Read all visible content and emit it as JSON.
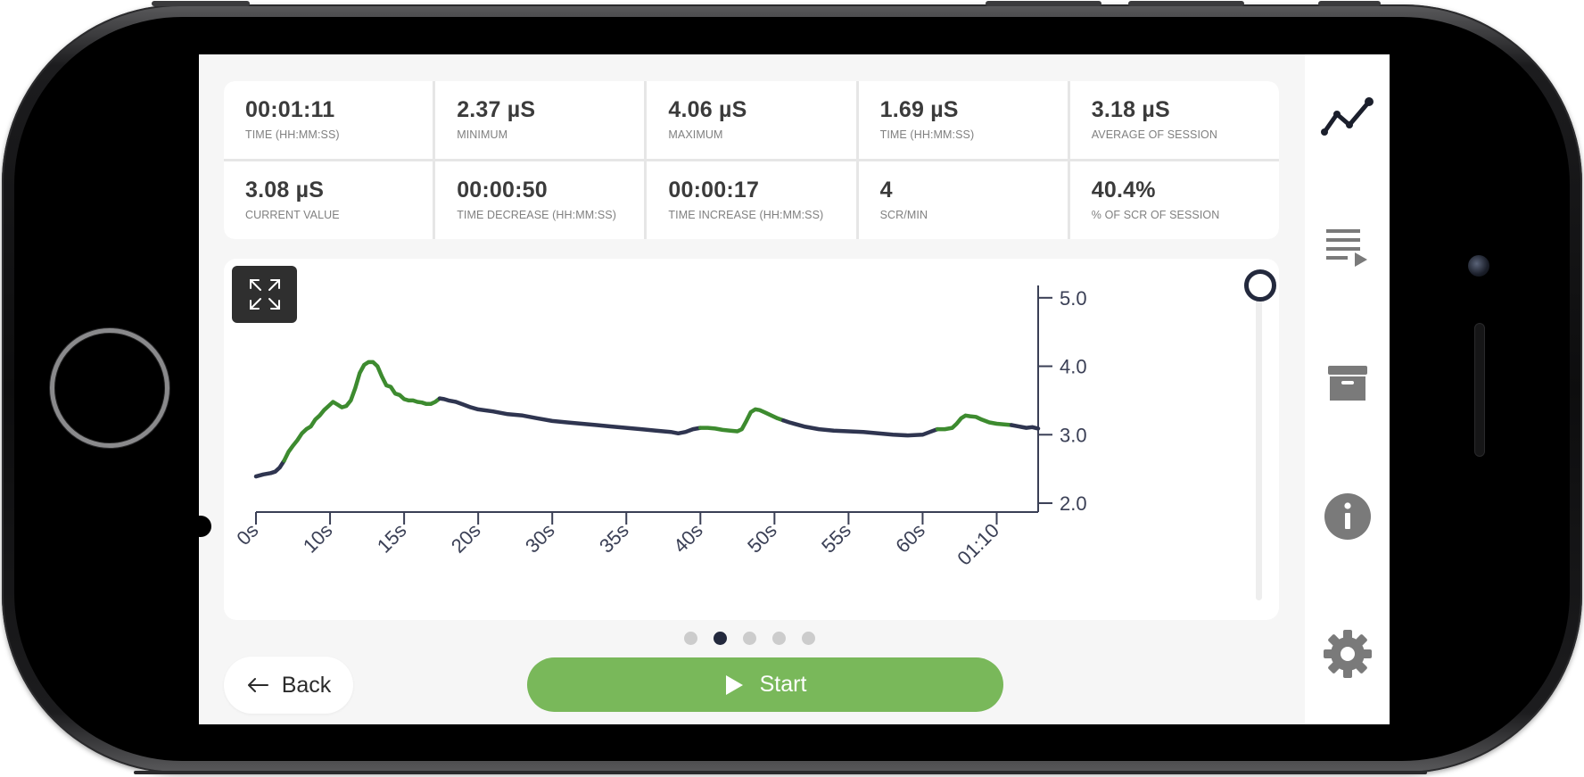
{
  "stats": [
    {
      "value": "00:01:11",
      "label": "TIME (HH:MM:SS)"
    },
    {
      "value": "2.37 µS",
      "label": "MINIMUM"
    },
    {
      "value": "4.06 µS",
      "label": "MAXIMUM"
    },
    {
      "value": "1.69 µS",
      "label": "TIME (HH:MM:SS)"
    },
    {
      "value": "3.18 µS",
      "label": "AVERAGE OF SESSION"
    },
    {
      "value": "3.08 µS",
      "label": "CURRENT VALUE"
    },
    {
      "value": "00:00:50",
      "label": "TIME DECREASE (HH:MM:SS)"
    },
    {
      "value": "00:00:17",
      "label": "TIME INCREASE (HH:MM:SS)"
    },
    {
      "value": "4",
      "label": "SCR/MIN"
    },
    {
      "value": "40.4%",
      "label": "% of SCR OF SESSION"
    }
  ],
  "icons": {
    "expand": "expand-icon",
    "nav": [
      "line-chart-icon",
      "playlist-icon",
      "archive-icon",
      "info-icon",
      "settings-icon"
    ],
    "back": "arrow-left-icon",
    "start": "play-icon"
  },
  "colors": {
    "series_normal": "#2f3550",
    "series_scr": "#3d8b2f",
    "start_button": "#79b85a",
    "slider_thumb": "#23293d"
  },
  "pager": {
    "count": 5,
    "active": 1
  },
  "buttons": {
    "back": "Back",
    "start": "Start"
  },
  "chart_data": {
    "type": "line",
    "xlabel": "",
    "ylabel": "",
    "xticks": [
      0,
      5,
      10,
      15,
      20,
      25,
      30,
      35,
      40,
      45,
      50,
      55,
      60
    ],
    "xtick_labels": [
      "0s",
      "10s",
      "15s",
      "20s",
      "30s",
      "35s",
      "40s",
      "50s",
      "55s",
      "60s",
      "01:10"
    ],
    "xtick_positions": [
      0,
      5,
      10,
      15,
      20,
      25,
      30,
      35,
      40,
      45,
      50
    ],
    "yticks": [
      2.0,
      3.0,
      4.0,
      5.0
    ],
    "ytick_labels": [
      "2.0",
      "3.0",
      "4.0",
      "5.0"
    ],
    "ylim": [
      1.87,
      5.18
    ],
    "xlim": [
      0,
      52.8
    ],
    "y_axis_position": "right",
    "series": [
      {
        "points": [
          [
            0.0,
            2.39
          ],
          [
            0.5,
            2.42
          ],
          [
            1.0,
            2.44
          ],
          [
            1.3,
            2.46
          ],
          [
            1.6,
            2.52
          ],
          [
            1.9,
            2.62
          ],
          [
            2.2,
            2.75
          ],
          [
            2.5,
            2.84
          ],
          [
            2.8,
            2.92
          ],
          [
            3.1,
            3.02
          ],
          [
            3.4,
            3.08
          ],
          [
            3.7,
            3.12
          ],
          [
            4.0,
            3.22
          ],
          [
            4.3,
            3.28
          ],
          [
            4.6,
            3.36
          ],
          [
            4.9,
            3.42
          ],
          [
            5.2,
            3.48
          ],
          [
            5.5,
            3.44
          ],
          [
            5.8,
            3.4
          ],
          [
            6.1,
            3.42
          ],
          [
            6.4,
            3.5
          ],
          [
            6.7,
            3.68
          ],
          [
            7.0,
            3.9
          ],
          [
            7.3,
            4.02
          ],
          [
            7.6,
            4.06
          ],
          [
            7.9,
            4.06
          ],
          [
            8.2,
            4.0
          ],
          [
            8.5,
            3.85
          ],
          [
            8.8,
            3.72
          ],
          [
            9.1,
            3.7
          ],
          [
            9.4,
            3.6
          ],
          [
            9.7,
            3.58
          ],
          [
            10.0,
            3.52
          ],
          [
            10.3,
            3.5
          ],
          [
            10.6,
            3.5
          ],
          [
            10.9,
            3.48
          ],
          [
            11.2,
            3.47
          ],
          [
            11.5,
            3.45
          ],
          [
            11.8,
            3.45
          ],
          [
            12.1,
            3.48
          ],
          [
            12.4,
            3.53
          ],
          [
            12.7,
            3.52
          ],
          [
            13.0,
            3.5
          ],
          [
            13.5,
            3.48
          ],
          [
            14.0,
            3.44
          ],
          [
            14.5,
            3.4
          ],
          [
            15.0,
            3.37
          ],
          [
            16.0,
            3.34
          ],
          [
            17.0,
            3.3
          ],
          [
            18.0,
            3.28
          ],
          [
            19.0,
            3.24
          ],
          [
            20.0,
            3.2
          ],
          [
            21.0,
            3.18
          ],
          [
            22.0,
            3.16
          ],
          [
            23.0,
            3.14
          ],
          [
            24.0,
            3.12
          ],
          [
            25.0,
            3.1
          ],
          [
            26.0,
            3.08
          ],
          [
            27.0,
            3.06
          ],
          [
            28.0,
            3.04
          ],
          [
            28.5,
            3.02
          ],
          [
            29.0,
            3.04
          ],
          [
            29.5,
            3.08
          ],
          [
            30.0,
            3.1
          ],
          [
            30.5,
            3.1
          ],
          [
            31.0,
            3.09
          ],
          [
            31.5,
            3.07
          ],
          [
            32.0,
            3.06
          ],
          [
            32.5,
            3.05
          ],
          [
            32.8,
            3.08
          ],
          [
            33.1,
            3.2
          ],
          [
            33.4,
            3.33
          ],
          [
            33.7,
            3.37
          ],
          [
            34.0,
            3.36
          ],
          [
            34.4,
            3.32
          ],
          [
            34.8,
            3.28
          ],
          [
            35.2,
            3.24
          ],
          [
            35.6,
            3.21
          ],
          [
            36.0,
            3.18
          ],
          [
            37.0,
            3.12
          ],
          [
            38.0,
            3.08
          ],
          [
            39.0,
            3.06
          ],
          [
            40.0,
            3.05
          ],
          [
            41.0,
            3.04
          ],
          [
            42.0,
            3.02
          ],
          [
            43.0,
            3.0
          ],
          [
            44.0,
            2.99
          ],
          [
            45.0,
            3.0
          ],
          [
            45.5,
            3.04
          ],
          [
            46.0,
            3.08
          ],
          [
            46.5,
            3.08
          ],
          [
            47.0,
            3.1
          ],
          [
            47.3,
            3.16
          ],
          [
            47.6,
            3.24
          ],
          [
            47.9,
            3.28
          ],
          [
            48.2,
            3.27
          ],
          [
            48.6,
            3.26
          ],
          [
            49.0,
            3.22
          ],
          [
            49.5,
            3.18
          ],
          [
            50.0,
            3.16
          ],
          [
            50.5,
            3.15
          ],
          [
            51.0,
            3.14
          ],
          [
            51.5,
            3.12
          ],
          [
            52.0,
            3.1
          ],
          [
            52.4,
            3.11
          ],
          [
            52.8,
            3.09
          ]
        ]
      }
    ],
    "highlight_ranges": [
      [
        1.9,
        12.2
      ],
      [
        30.0,
        32.8
      ],
      [
        32.8,
        35.2
      ],
      [
        46.0,
        50.8
      ]
    ]
  }
}
